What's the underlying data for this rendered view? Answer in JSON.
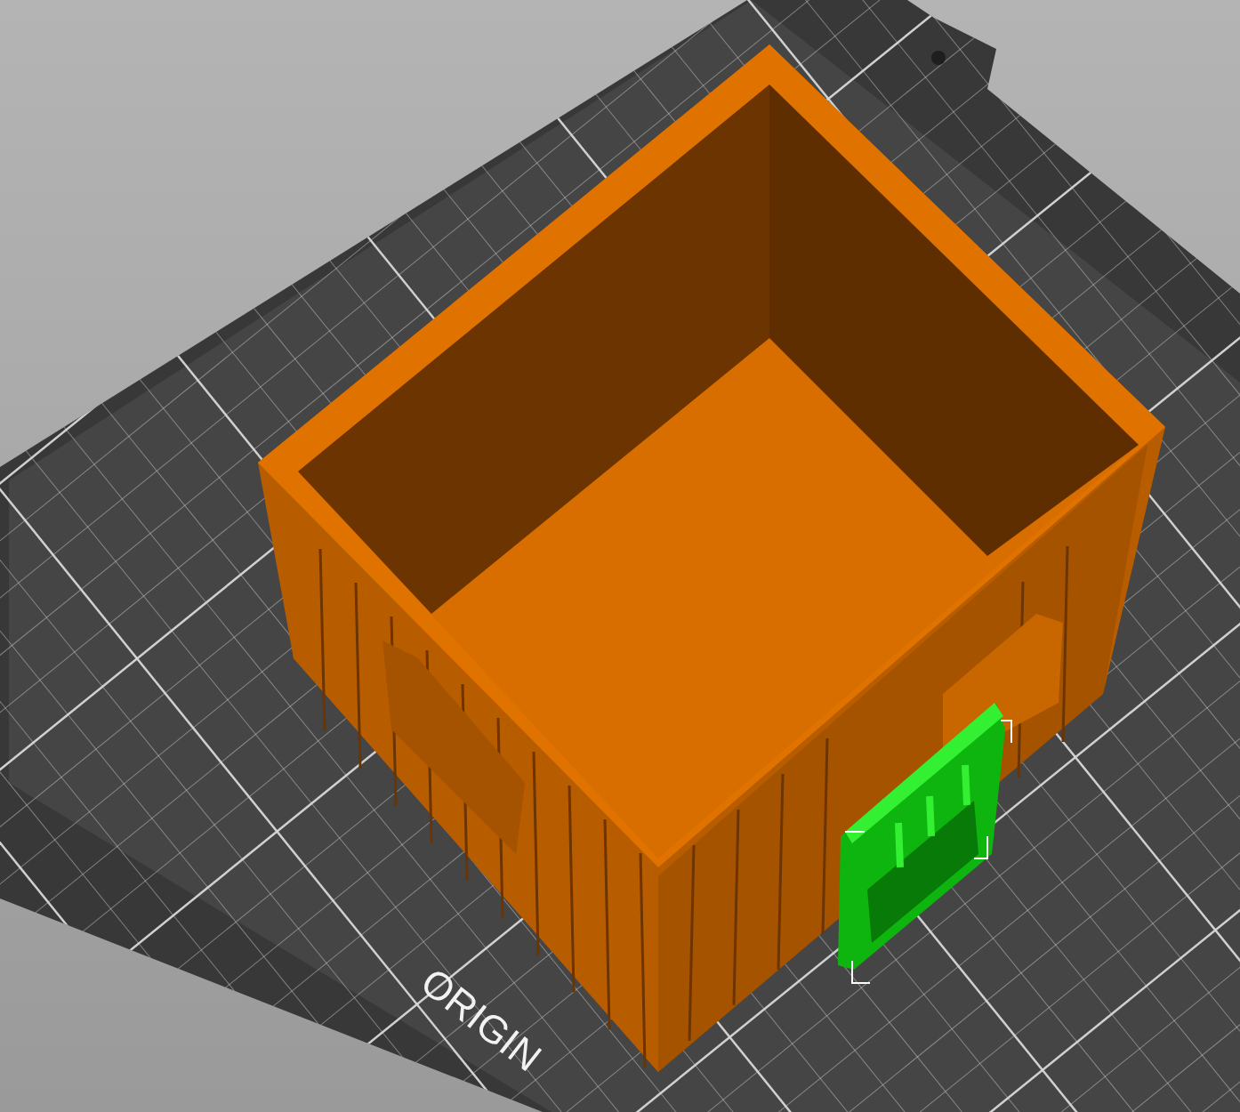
{
  "viewport": {
    "bed_label": "ORIGIN",
    "objects": [
      {
        "kind": "container",
        "selected": false
      },
      {
        "kind": "door",
        "selected": true
      }
    ]
  }
}
